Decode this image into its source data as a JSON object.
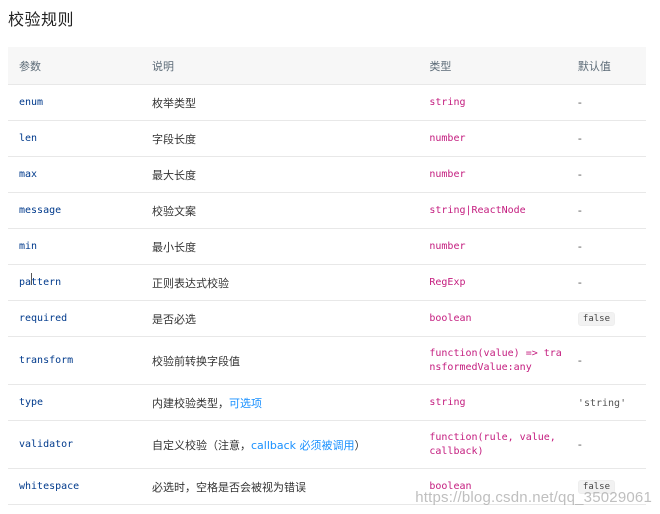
{
  "title": "校验规则",
  "table": {
    "headers": {
      "param": "参数",
      "desc": "说明",
      "type": "类型",
      "default": "默认值"
    },
    "rows": [
      {
        "param": "enum",
        "desc": "枚举类型",
        "desc_link": "",
        "desc_suffix": "",
        "type": "string",
        "default": "-",
        "default_badge": false
      },
      {
        "param": "len",
        "desc": "字段长度",
        "desc_link": "",
        "desc_suffix": "",
        "type": "number",
        "default": "-",
        "default_badge": false
      },
      {
        "param": "max",
        "desc": "最大长度",
        "desc_link": "",
        "desc_suffix": "",
        "type": "number",
        "default": "-",
        "default_badge": false
      },
      {
        "param": "message",
        "desc": "校验文案",
        "desc_link": "",
        "desc_suffix": "",
        "type": "string|ReactNode",
        "default": "-",
        "default_badge": false
      },
      {
        "param": "min",
        "desc": "最小长度",
        "desc_link": "",
        "desc_suffix": "",
        "type": "number",
        "default": "-",
        "default_badge": false
      },
      {
        "param": "pattern",
        "desc": "正则表达式校验",
        "desc_link": "",
        "desc_suffix": "",
        "type": "RegExp",
        "default": "-",
        "default_badge": false
      },
      {
        "param": "required",
        "desc": "是否必选",
        "desc_link": "",
        "desc_suffix": "",
        "type": "boolean",
        "default": "false",
        "default_badge": true
      },
      {
        "param": "transform",
        "desc": "校验前转换字段值",
        "desc_link": "",
        "desc_suffix": "",
        "type": "function(value) => tra\nnsformedValue:any",
        "default": "-",
        "default_badge": false,
        "tall": true
      },
      {
        "param": "type",
        "desc": "内建校验类型，",
        "desc_link": "可选项",
        "desc_suffix": "",
        "type": "string",
        "default": "'string'",
        "default_badge": false
      },
      {
        "param": "validator",
        "desc": "自定义校验（注意，",
        "desc_link": "callback 必须被调用",
        "desc_suffix": "）",
        "type": "function(rule, value,\ncallback)",
        "default": "-",
        "default_badge": false,
        "tall": true
      },
      {
        "param": "whitespace",
        "desc": "必选时，空格是否会被视为错误",
        "desc_link": "",
        "desc_suffix": "",
        "type": "boolean",
        "default": "false",
        "default_badge": true
      }
    ]
  },
  "watermark": "https://blog.csdn.net/qq_35029061"
}
